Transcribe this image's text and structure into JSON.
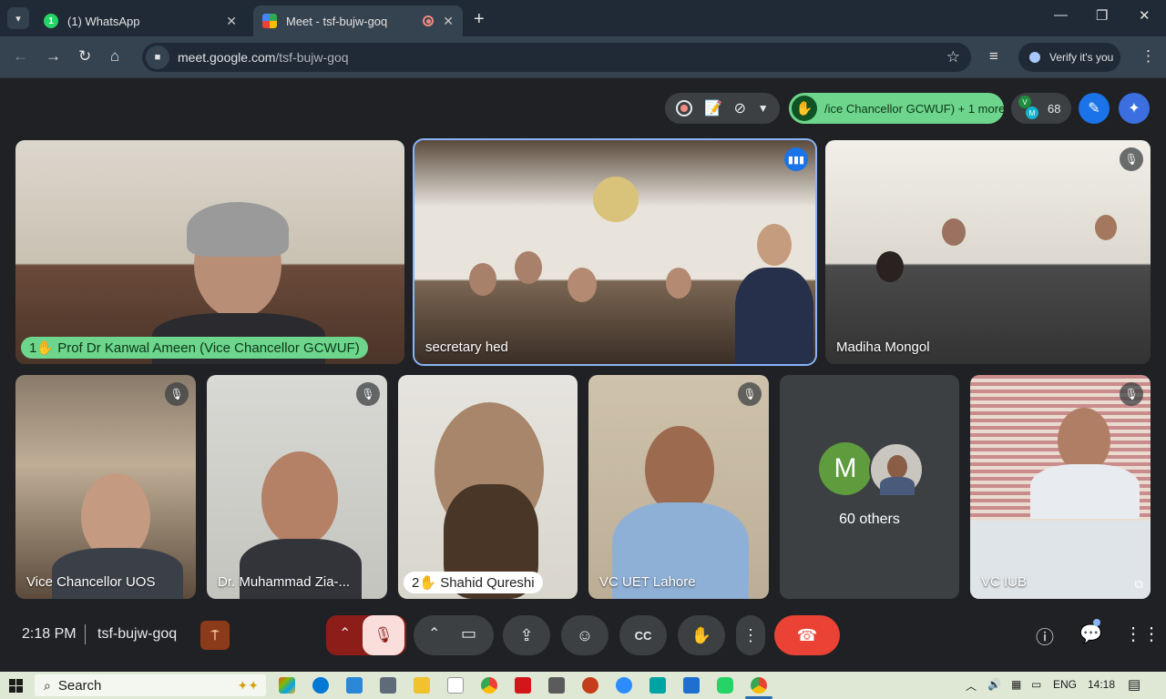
{
  "browser": {
    "tabs": [
      {
        "title": "(1) WhatsApp",
        "badge": "1",
        "active": false
      },
      {
        "title": "Meet - tsf-bujw-goq",
        "active": true
      }
    ],
    "url_host": "meet.google.com",
    "url_path": "/tsf-bujw-goq",
    "verify_label": "Verify it's you"
  },
  "meet": {
    "hand_raise_chip": "/ice Chancellor GCWUF) + 1 more",
    "participant_count": "68",
    "people_initials": [
      "V",
      "M"
    ],
    "tiles": [
      {
        "name": "Prof Dr Kanwal Ameen (Vice Chancellor GCWUF)",
        "hand_order": "1",
        "muted": false
      },
      {
        "name": "secretary hed",
        "speaking": true
      },
      {
        "name": "Madiha Mongol",
        "muted": true
      },
      {
        "name": "Vice Chancellor UOS",
        "muted": true
      },
      {
        "name": "Dr. Muhammad Zia-...",
        "muted": true
      },
      {
        "name": "Shahid Qureshi",
        "hand_order": "2",
        "muted": false
      },
      {
        "name": "VC UET Lahore",
        "muted": true
      },
      {
        "name": "VC IUB",
        "muted": true
      }
    ],
    "others": {
      "initial": "M",
      "label": "60 others"
    },
    "bottom": {
      "time": "2:18 PM",
      "meeting_code": "tsf-bujw-goq"
    }
  },
  "taskbar": {
    "search_placeholder": "Search",
    "language": "ENG",
    "clock": "14:18"
  },
  "colors": {
    "meet_bg": "#202124",
    "hand_green": "#6dd58c",
    "hangup_red": "#ea4335",
    "speaker_outline": "#8ab4f8",
    "taskbar_bg": "#dfe8d5"
  }
}
